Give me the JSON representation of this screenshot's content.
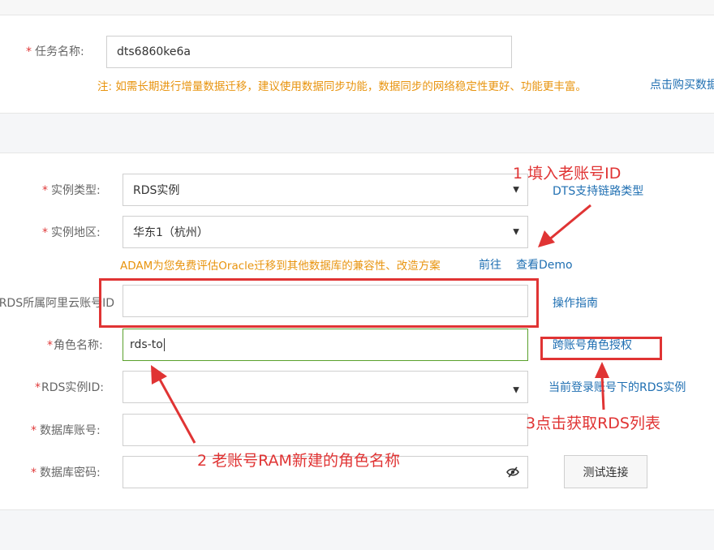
{
  "task": {
    "label": "任务名称:",
    "value": "dts6860ke6a",
    "note": "注: 如需长期进行增量数据迁移，建议使用数据同步功能，数据同步的网络稳定性更好、功能更丰富。",
    "note_link": "点击购买数据"
  },
  "instance_type": {
    "label": "实例类型:",
    "value": "RDS实例",
    "link": "DTS支持链路类型"
  },
  "region": {
    "label": "实例地区:",
    "value": "华东1（杭州）"
  },
  "adam": {
    "text": "ADAM为您免费评估Oracle迁移到其他数据库的兼容性、改造方案",
    "goto": "前往",
    "demo": "查看Demo"
  },
  "account_id": {
    "label": "RDS所属阿里云账号ID",
    "value": "",
    "link": "操作指南"
  },
  "role_name": {
    "label": "角色名称:",
    "value": "rds-to",
    "link": "跨账号角色授权"
  },
  "rds_instance": {
    "label": "RDS实例ID:",
    "value": "",
    "link": "当前登录账号下的RDS实例"
  },
  "db_account": {
    "label": "数据库账号:",
    "value": ""
  },
  "db_password": {
    "label": "数据库密码:",
    "value": "",
    "test_button": "测试连接"
  },
  "annotations": {
    "a1": "1  填入老账号ID",
    "a2": "2  老账号RAM新建的角色名称",
    "a3": "3点击获取RDS列表"
  },
  "colors": {
    "annotation_red": "#e03434",
    "link_blue": "#1f6fb2",
    "note_orange": "#e8940f",
    "required_red": "#e03a3a",
    "focused_border": "#5aa02c"
  },
  "icons": {
    "select_caret": "caret-down-icon",
    "password_toggle": "eye-slash-icon"
  }
}
